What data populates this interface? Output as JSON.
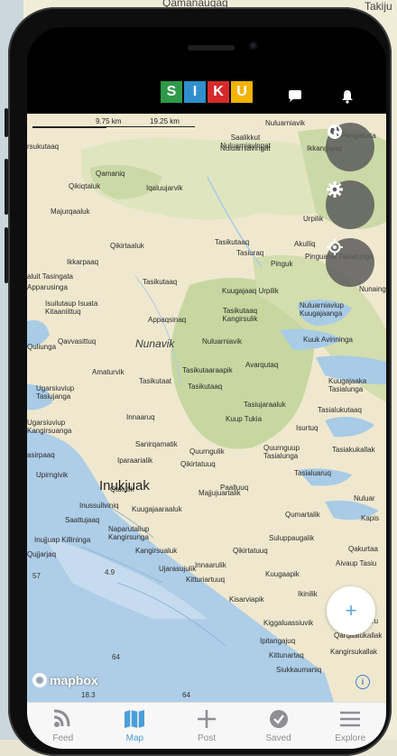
{
  "background_labels": {
    "top_center": "Qamanaugag",
    "top_right": "Takiju"
  },
  "header": {
    "logo_letters": [
      "S",
      "I",
      "K",
      "U"
    ],
    "logo_colors": [
      "#2e9a4a",
      "#2f8fcd",
      "#d62a2a",
      "#f2b300"
    ],
    "chat_icon": "chat-bubble-icon",
    "notification_icon": "bell-icon"
  },
  "map": {
    "scale": {
      "label_1": "9.75 km",
      "label_2": "19.25 km"
    },
    "region_label": "Nunavik",
    "main_town": "Inukjuak",
    "places": [
      {
        "text": "Saalikkut Nuluarniavingat"
      },
      {
        "text": "Nuluarniavik"
      },
      {
        "text": "Pangalurta"
      },
      {
        "text": "Ikkangajaq"
      },
      {
        "text": "Qamaniq"
      },
      {
        "text": "Iqaluujarvik"
      },
      {
        "text": "Majurqaaluk"
      },
      {
        "text": "Qikirtaaluk"
      },
      {
        "text": "Tasikutaaq"
      },
      {
        "text": "Pinguk"
      },
      {
        "text": "Pingualuit Tasialunga"
      },
      {
        "text": "Nunaing"
      },
      {
        "text": "Tasikutaaq"
      },
      {
        "text": "Kuugajaaq Urpilik"
      },
      {
        "text": "Isuilutaup Isuata Kitaaniittuq"
      },
      {
        "text": "Tasikutaaq Kangirsulik"
      },
      {
        "text": "Nuluarniaviup Kuugajaanga"
      },
      {
        "text": "Qavvasittuq"
      },
      {
        "text": "Nuluarniavik"
      },
      {
        "text": "Kuuk Avinninga"
      },
      {
        "text": "Amaturvik"
      },
      {
        "text": "Tasikutaat"
      },
      {
        "text": "Tasikutaaraapik"
      },
      {
        "text": "Avarqutaq"
      },
      {
        "text": "Tasikutaaq"
      },
      {
        "text": "Ugarsiuviup Tasiujanga"
      },
      {
        "text": "Kuugajaaka Tasialunga"
      },
      {
        "text": "Tasialukutaaq"
      },
      {
        "text": "Innaaruq"
      },
      {
        "text": "Kuup Tukia"
      },
      {
        "text": "Isurtuq"
      },
      {
        "text": "Sanirqamatik"
      },
      {
        "text": "Quurngulik"
      },
      {
        "text": "Quurnguup Tasialunga"
      },
      {
        "text": "Tasiakukallak"
      },
      {
        "text": "Iparaarialik"
      },
      {
        "text": "Qikirtatuuq"
      },
      {
        "text": "Tasialuaruq"
      },
      {
        "text": "Upirngivik"
      },
      {
        "text": "Majjujuartalik"
      },
      {
        "text": "Nuluar"
      },
      {
        "text": "Inussuliviniq"
      },
      {
        "text": "Kuugajaaraaluk"
      },
      {
        "text": "Qumartalik"
      },
      {
        "text": "Kapis"
      },
      {
        "text": "Saattujaaq"
      },
      {
        "text": "Naparutaliup Kangirsunga"
      },
      {
        "text": "Suluppaugalik"
      },
      {
        "text": "Inujjuap Killininga"
      },
      {
        "text": "Qikirtatuuq"
      },
      {
        "text": "Qakurtaa"
      },
      {
        "text": "Kangirsualuk"
      },
      {
        "text": "Innaarulik"
      },
      {
        "text": "Aivaup Tasiu"
      },
      {
        "text": "Ujarasujulik"
      },
      {
        "text": "Kuugaapik"
      },
      {
        "text": "Kitturiartuuq"
      },
      {
        "text": "Ikinilik"
      },
      {
        "text": "Kisarviapik"
      },
      {
        "text": "Kiggaluassiuvik"
      },
      {
        "text": "Innaaru"
      },
      {
        "text": "Qarqaalukallak"
      },
      {
        "text": "Ipitangajuq"
      },
      {
        "text": "Kittunartaq"
      },
      {
        "text": "Kangirsukallak"
      },
      {
        "text": "Siukkaumaniq"
      },
      {
        "text": "Qikiqtaluk"
      },
      {
        "text": "Nuluarniavingat"
      },
      {
        "text": "Tasiuraq"
      },
      {
        "text": "Ikkarpaaq"
      },
      {
        "text": "Appaqsinaq"
      },
      {
        "text": "Tasiujaraaluk"
      },
      {
        "text": "Urpilik"
      },
      {
        "text": "Paalluuq"
      },
      {
        "text": "Qakulik"
      },
      {
        "text": "Akulliq"
      }
    ],
    "left_edge_labels": [
      {
        "text": "rsukutaaq"
      },
      {
        "text": "aluit Tasingata"
      },
      {
        "text": "Apparusinga"
      },
      {
        "text": "Quliunga"
      },
      {
        "text": "Ugarsiuviup Kangirsuanga"
      },
      {
        "text": "asirpaaq"
      },
      {
        "text": "Qujjarjaq"
      }
    ],
    "depths": [
      "57",
      "4.9",
      "64",
      "18.3",
      "64"
    ],
    "attribution": "mapbox",
    "info_icon": "info-icon",
    "fab_icons": [
      "globe-icon",
      "gear-icon",
      "locate-icon"
    ],
    "add_button_label": "+"
  },
  "tabbar": {
    "tabs": [
      {
        "label": "Feed",
        "icon": "rss-icon",
        "active": false
      },
      {
        "label": "Map",
        "icon": "map-icon",
        "active": true
      },
      {
        "label": "Post",
        "icon": "plus-icon",
        "active": false
      },
      {
        "label": "Saved",
        "icon": "checkmark-circle-icon",
        "active": false
      },
      {
        "label": "Explore",
        "icon": "menu-icon",
        "active": false
      }
    ]
  }
}
